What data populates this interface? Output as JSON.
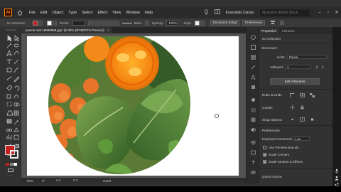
{
  "menubar": {
    "logo": "Ai",
    "items": [
      "File",
      "Edit",
      "Object",
      "Type",
      "Select",
      "Effect",
      "View",
      "Window",
      "Help"
    ],
    "workspace": "Essentials Classic",
    "search_placeholder": "Search Adobe Stock"
  },
  "control": {
    "selection": "No Selection",
    "stroke_label": "Stroke:",
    "brush": "Basic",
    "opacity_label": "Opacity:",
    "opacity": "100%",
    "style_label": "Style:",
    "doc_setup": "Document Setup",
    "preferences": "Preferences",
    "fill_color": "#c8201e"
  },
  "document": {
    "tab_title": "pexels-nati-16999658.jpg* @ 50% (RGB/GPU Preview)",
    "zoom": "50%",
    "tool_name": "Hand"
  },
  "panel": {
    "tabs": [
      "Properties",
      "Libraries"
    ],
    "no_selection": "No Selection",
    "document_label": "Document",
    "units_label": "Units:",
    "units_value": "Pixels",
    "artboard_label": "Artboard:",
    "artboard_value": "1",
    "edit_artboards": "Edit Artboards",
    "rulers_grids": "Ruler & Grids",
    "guides": "Guides",
    "snap_options": "Snap Options",
    "preferences_label": "Preferences",
    "keyboard_increment_label": "Keyboard Increment:",
    "keyboard_increment_value": "1 px",
    "use_preview_bounds": "Use Preview Bounds",
    "scale_corners": "Scale Corners",
    "scale_strokes": "Scale Strokes & Effects",
    "quick_actions": "Quick Actions"
  },
  "colors": {
    "accent": "#ff9a00",
    "fill": "#c8201e"
  }
}
